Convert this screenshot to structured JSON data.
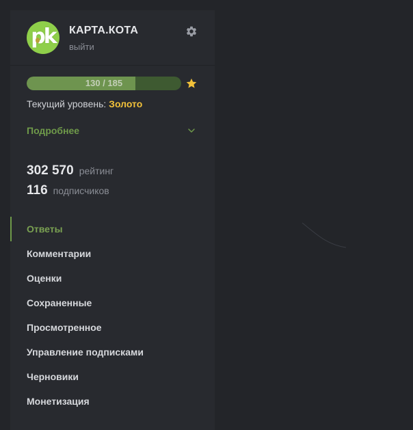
{
  "profile": {
    "avatar_initials": "pk",
    "username": "КАРТА.КОТА",
    "logout_label": "выйти",
    "icons": {
      "settings": "gear-icon",
      "star": "star-icon",
      "details": "chevron-down-icon"
    }
  },
  "level": {
    "progress_text": "130 / 185",
    "progress_current": 130,
    "progress_max": 185,
    "label": "Текущий уровень:",
    "value": "Золото",
    "details_label": "Подробнее"
  },
  "stats": {
    "rating_value": "302 570",
    "rating_label": "рейтинг",
    "subscribers_value": "116",
    "subscribers_label": "подписчиков"
  },
  "menu": [
    {
      "label": "Ответы",
      "active": true
    },
    {
      "label": "Комментарии",
      "active": false
    },
    {
      "label": "Оценки",
      "active": false
    },
    {
      "label": "Сохраненные",
      "active": false
    },
    {
      "label": "Просмотренное",
      "active": false
    },
    {
      "label": "Управление подписками",
      "active": false
    },
    {
      "label": "Черновики",
      "active": false
    },
    {
      "label": "Монетизация",
      "active": false
    }
  ],
  "colors": {
    "background": "#232529",
    "panel": "#282a2f",
    "accent_green": "#6f9a4a",
    "gold": "#f2c13a",
    "avatar_bg": "#8fcf4a"
  }
}
